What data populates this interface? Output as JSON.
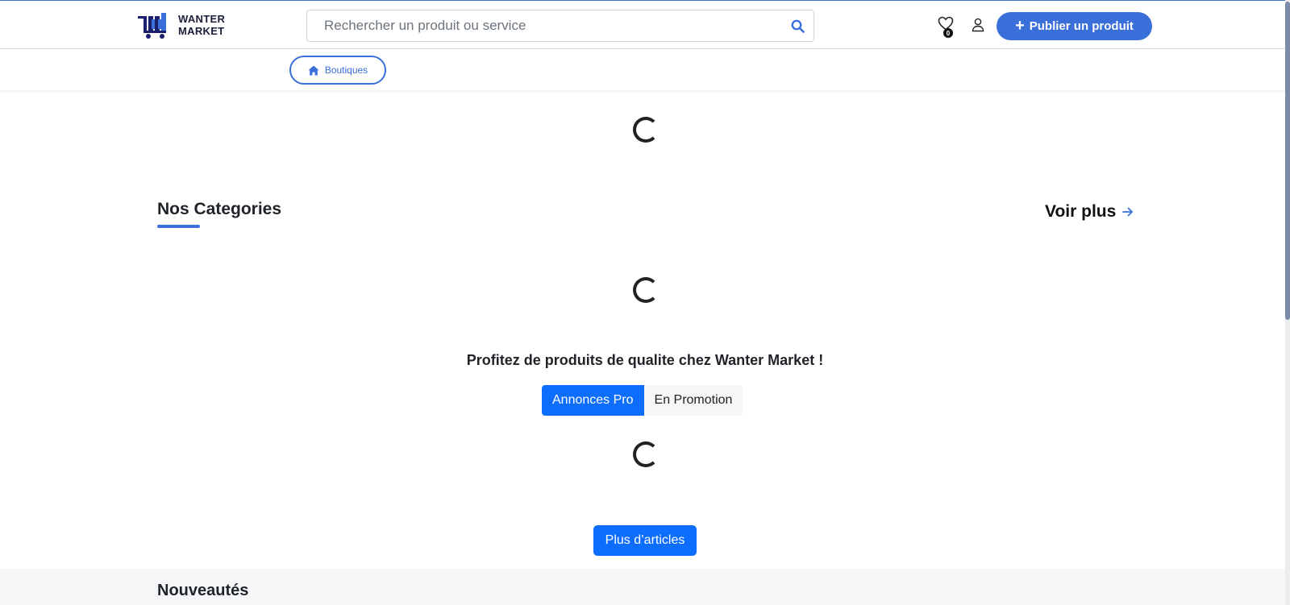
{
  "brand": {
    "line1": "WANTER",
    "line2": "MARKET"
  },
  "search": {
    "placeholder": "Rechercher un produit ou service"
  },
  "header": {
    "favorites_count": "0",
    "publish_label": "Publier un produit"
  },
  "subnav": {
    "shops_label": "Boutiques"
  },
  "categories": {
    "title": "Nos Categories",
    "see_more": "Voir plus"
  },
  "promo": {
    "text": "Profitez de produits de qualite chez Wanter Market !",
    "tabs": [
      {
        "label": "Annonces Pro",
        "active": true
      },
      {
        "label": "En Promotion",
        "active": false
      }
    ],
    "more_button": "Plus d’articles"
  },
  "new_items": {
    "title": "Nouveautés"
  },
  "colors": {
    "accent": "#3a6fd9",
    "primary_button": "#0d6efd",
    "logo_dark": "#1a1f6e"
  }
}
